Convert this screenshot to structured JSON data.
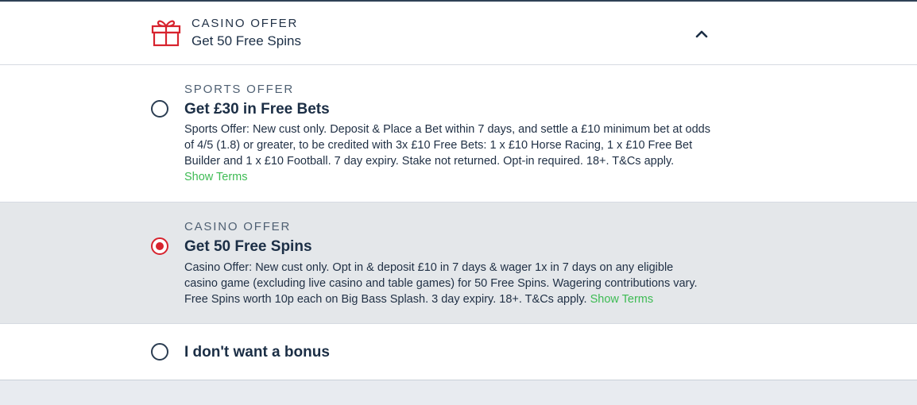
{
  "header": {
    "icon": "gift-icon",
    "kicker": "CASINO OFFER",
    "title": "Get 50 Free Spins",
    "toggle_icon": "chevron-up-icon"
  },
  "options": [
    {
      "kicker": "SPORTS OFFER",
      "title": "Get £30 in Free Bets",
      "description": "Sports Offer: New cust only. Deposit & Place a Bet within 7 days, and settle a £10 minimum bet at odds of 4/5 (1.8) or greater, to be credited with 3x £10 Free Bets: 1 x £10 Horse Racing, 1 x £10 Free Bet Builder and 1 x £10 Football. 7 day expiry. Stake not returned. Opt-in required. 18+. T&Cs apply.",
      "terms_link": "Show Terms",
      "selected": false
    },
    {
      "kicker": "CASINO OFFER",
      "title": "Get 50 Free Spins",
      "description": "Casino Offer: New cust only. Opt in & deposit £10 in 7 days & wager 1x in 7 days on any eligible casino game (excluding live casino and table games) for 50 Free Spins. Wagering contributions vary. Free Spins worth 10p each on Big Bass Splash. 3 day expiry. 18+. T&Cs apply.",
      "terms_link": "Show Terms",
      "selected": true
    },
    {
      "title": "I don't want a bonus",
      "selected": false
    }
  ],
  "colors": {
    "accent_red": "#d7232e",
    "link_green": "#3dbb53",
    "text_navy": "#1b2e45",
    "selected_bg": "#e4e7ea"
  }
}
